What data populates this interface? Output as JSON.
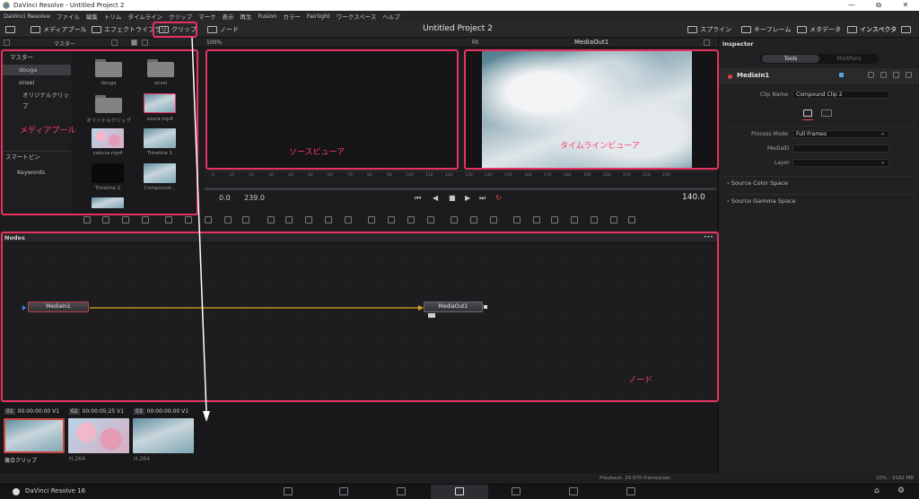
{
  "window": {
    "title": "DaVinci Resolve - Untitled Project 2",
    "minimize": "—",
    "maximize": "⧉",
    "close": "✕"
  },
  "menu": [
    "DaVinci Resolve",
    "ファイル",
    "編集",
    "トリム",
    "タイムライン",
    "クリップ",
    "マーク",
    "表示",
    "再生",
    "Fusion",
    "カラー",
    "Fairlight",
    "ワークスペース",
    "ヘルプ"
  ],
  "toolbar": {
    "media_pool": "メディアプール",
    "effects_library": "エフェクトライブラリ",
    "clips": "クリップ",
    "nodes": "ノード",
    "project_title": "Untitled Project 2",
    "spline": "スプライン",
    "keyframes": "キーフレーム",
    "metadata": "メタデータ",
    "inspector": "インスペクタ"
  },
  "subbar": {
    "master": "マスター",
    "zoom": "100%",
    "fit": "Fit",
    "viewer_name": "MediaOut1"
  },
  "bins": {
    "master": "マスター",
    "items": [
      "douga",
      "onsei"
    ],
    "original": "オリジナルクリップ",
    "smart_bins": "スマートビン",
    "keywords": "Keywords"
  },
  "pool_items": [
    {
      "label": "douga",
      "kind": "folder"
    },
    {
      "label": "onsei",
      "kind": "folder"
    },
    {
      "label": "オリジナルクリップ",
      "kind": "folder"
    },
    {
      "label": "xsora.mp4",
      "kind": "sky"
    },
    {
      "label": "sakura.mp4",
      "kind": "cherry"
    },
    {
      "label": "Timeline 1",
      "kind": "sky"
    },
    {
      "label": "Timeline 2",
      "kind": "dark"
    },
    {
      "label": "Compound...",
      "kind": "sky"
    }
  ],
  "annotations": {
    "media_pool": "メディアプール",
    "source_viewer": "ソースビューア",
    "timeline_viewer": "タイムラインビューア",
    "nodes": "ノード"
  },
  "ruler": [
    "0",
    "10",
    "20",
    "30",
    "40",
    "50",
    "60",
    "70",
    "80",
    "90",
    "100",
    "110",
    "120",
    "130",
    "140",
    "150",
    "160",
    "170",
    "180",
    "190",
    "200",
    "210",
    "220",
    "230"
  ],
  "transport": {
    "in": "0.0",
    "duration": "239.0",
    "current": "140.0",
    "skip_back": "⏮",
    "prev": "◀",
    "stop": "■",
    "play": "▶",
    "skip_fwd": "⏭",
    "loop": "↻"
  },
  "nodes_panel": {
    "title": "Nodes",
    "menu": "•••",
    "node_in": "MediaIn1",
    "node_out": "MediaOut1"
  },
  "clips_strip": [
    {
      "index": "01",
      "timecode": "00:00:00:00",
      "track": "V1",
      "label": "複合クリップ",
      "kind": "sky"
    },
    {
      "index": "02",
      "timecode": "00:00:05:25",
      "track": "V1",
      "label": "H.264",
      "kind": "cherry"
    },
    {
      "index": "03",
      "timecode": "00:00:00:00",
      "track": "V1",
      "label": "H.264",
      "kind": "sky"
    }
  ],
  "inspector": {
    "title": "Inspector",
    "tab_tools": "Tools",
    "tab_modifiers": "Modifiers",
    "node_name": "MediaIn1",
    "clip_name_label": "Clip Name",
    "clip_name_value": "Compound Clip 2",
    "process_mode_label": "Process Mode",
    "process_mode_value": "Full Frames",
    "media_id_label": "MediaID",
    "layer_label": "Layer",
    "source_color_space": "Source Color Space",
    "source_gamma_space": "Source Gamma Space",
    "dropdown_caret": "⌄",
    "section_arrow": "›"
  },
  "status": {
    "playback": "Playback: 29.970 frames/sec",
    "memory": "10% - 3182 MB"
  },
  "pagebar": {
    "app": "DaVinci Resolve 16",
    "home": "⌂",
    "settings": "⚙"
  },
  "colors": {
    "accent_red": "#e8325f",
    "connector": "#d8a520",
    "loop_red": "#e84a3a"
  }
}
